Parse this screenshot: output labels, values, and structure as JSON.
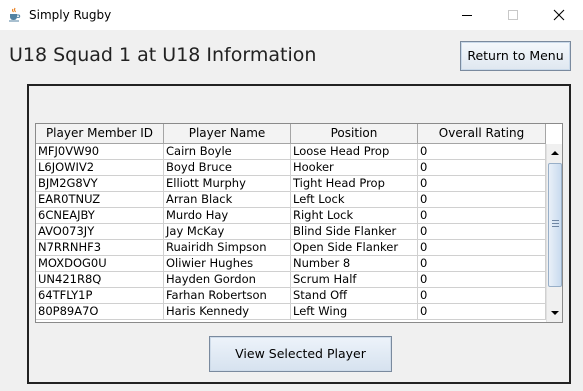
{
  "window": {
    "title": "Simply Rugby"
  },
  "page": {
    "title": "U18 Squad 1 at U18 Information"
  },
  "buttons": {
    "return_menu": "Return to Menu",
    "view_player": "View Selected Player"
  },
  "table": {
    "columns": [
      "Player Member ID",
      "Player Name",
      "Position",
      "Overall Rating"
    ],
    "rows": [
      [
        "MFJ0VW90",
        "Cairn Boyle",
        "Loose Head Prop",
        "0"
      ],
      [
        "L6JOWIV2",
        "Boyd Bruce",
        "Hooker",
        "0"
      ],
      [
        "BJM2G8VY",
        "Elliott Murphy",
        "Tight Head Prop",
        "0"
      ],
      [
        "EAR0TNUZ",
        "Arran Black",
        "Left Lock",
        "0"
      ],
      [
        "6CNEAJBY",
        "Murdo Hay",
        "Right Lock",
        "0"
      ],
      [
        "AVO073JY",
        "Jay McKay",
        "Blind Side Flanker",
        "0"
      ],
      [
        "N7RRNHF3",
        "Ruairidh Simpson",
        "Open Side Flanker",
        "0"
      ],
      [
        "MOXDOG0U",
        "Oliwier Hughes",
        "Number 8",
        "0"
      ],
      [
        "UN421R8Q",
        "Hayden Gordon",
        "Scrum Half",
        "0"
      ],
      [
        "64TFLY1P",
        "Farhan Robertson",
        "Stand Off",
        "0"
      ],
      [
        "80P89A7O",
        "Haris Kennedy",
        "Left Wing",
        "0"
      ]
    ]
  },
  "icons": {
    "app": "java-cup-icon",
    "minimize": "minimize-icon",
    "maximize": "maximize-icon",
    "close": "close-icon",
    "scroll_up": "arrow-up-icon",
    "scroll_down": "arrow-down-icon"
  },
  "colors": {
    "button_border": "#7a8a9e",
    "scroll_thumb": "#c9dbef"
  }
}
